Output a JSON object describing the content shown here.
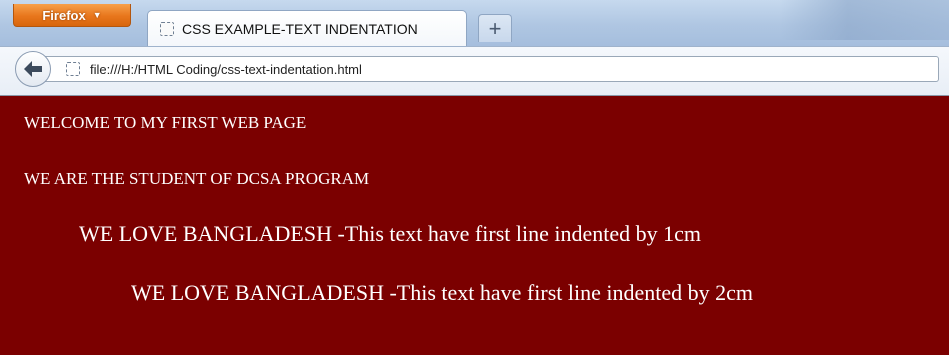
{
  "browser": {
    "menu_button_label": "Firefox",
    "tab": {
      "title": "CSS EXAMPLE-TEXT INDENTATION"
    },
    "new_tab_symbol": "+",
    "address": "file:///H:/HTML Coding/css-text-indentation.html"
  },
  "page": {
    "background_color": "#7b0000",
    "text_color": "#ffffff",
    "lines": [
      "WELCOME TO MY FIRST WEB PAGE",
      "WE ARE THE STUDENT OF DCSA PROGRAM",
      "WE LOVE BANGLADESH -This text have first line indented by 1cm",
      "WE LOVE BANGLADESH -This text have first line indented by 2cm"
    ]
  },
  "icons": {
    "back": "back-arrow-icon",
    "tab_page": "page-icon",
    "url_site": "page-icon",
    "menu_dropdown": "chevron-down-icon"
  }
}
